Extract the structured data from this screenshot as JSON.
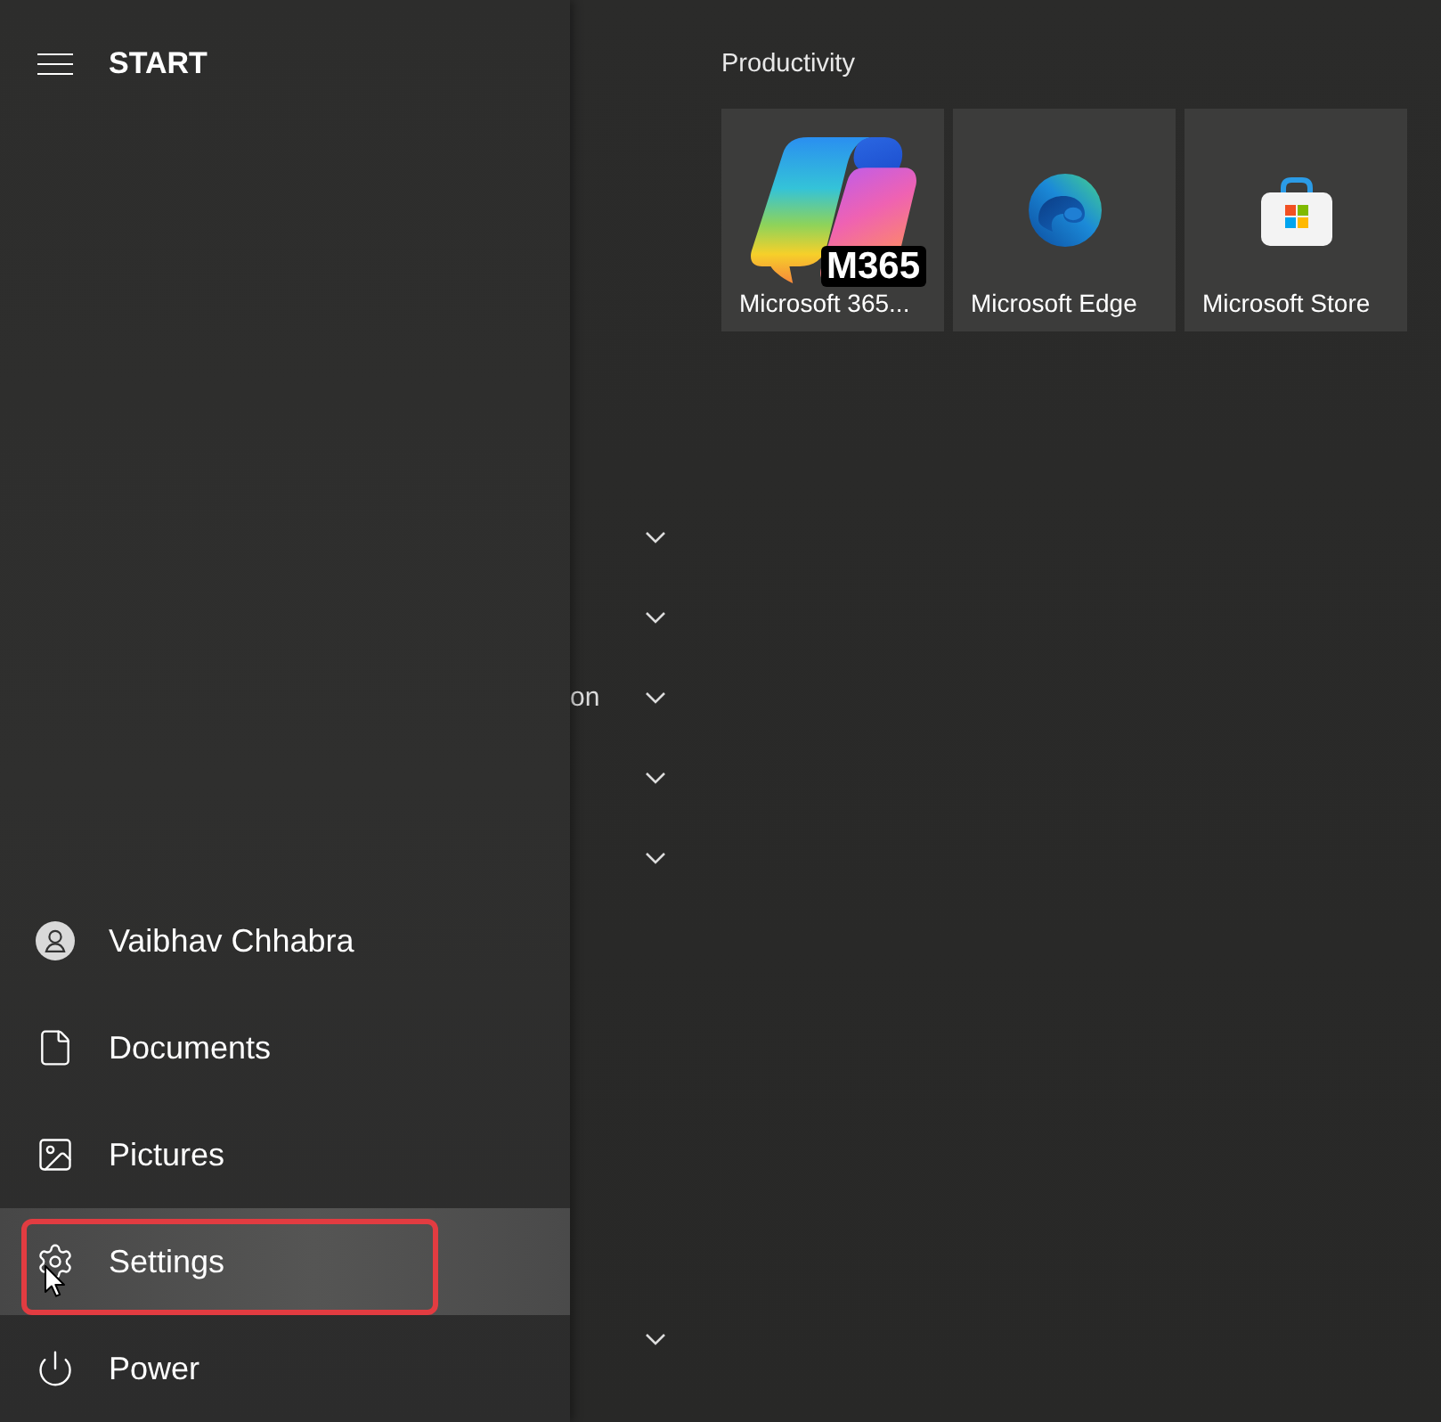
{
  "nav": {
    "title": "START",
    "items": [
      {
        "kind": "user",
        "label": "Vaibhav Chhabra",
        "hovered": false,
        "annotated": false
      },
      {
        "kind": "documents",
        "label": "Documents",
        "hovered": false,
        "annotated": false
      },
      {
        "kind": "pictures",
        "label": "Pictures",
        "hovered": false,
        "annotated": false
      },
      {
        "kind": "settings",
        "label": "Settings",
        "hovered": true,
        "annotated": true
      },
      {
        "kind": "power",
        "label": "Power",
        "hovered": false,
        "annotated": false
      }
    ]
  },
  "app_list": {
    "folders": [
      {
        "expanded": false
      },
      {
        "expanded": false
      },
      {
        "label": "on",
        "expanded": false
      },
      {
        "expanded": false
      },
      {
        "expanded": false
      },
      {
        "expanded": false
      }
    ]
  },
  "tiles": {
    "group_title": "Productivity",
    "items": [
      {
        "kind": "m365",
        "label": "Microsoft 365...",
        "badge": "M365"
      },
      {
        "kind": "edge",
        "label": "Microsoft Edge"
      },
      {
        "kind": "store",
        "label": "Microsoft Store"
      }
    ]
  }
}
